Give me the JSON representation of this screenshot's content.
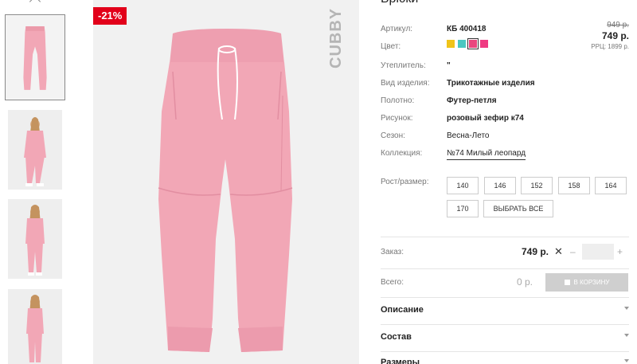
{
  "product": {
    "title": "Брюки",
    "discount_badge": "-21%",
    "brand": "CUBBY"
  },
  "details": {
    "article_label": "Артикул:",
    "article_value": "КБ 400418",
    "color_label": "Цвет:",
    "swatches": [
      {
        "color": "#f0c419",
        "selected": false
      },
      {
        "color": "#4ac7c1",
        "selected": false
      },
      {
        "color": "#e9467e",
        "selected": true
      },
      {
        "color": "#ef3a82",
        "selected": false
      }
    ],
    "insulation_label": "Утеплитель:",
    "insulation_value": "\"",
    "kind_label": "Вид изделия:",
    "kind_value": "Трикотажные изделия",
    "fabric_label": "Полотно:",
    "fabric_value": "Футер-петля",
    "pattern_label": "Рисунок:",
    "pattern_value": "розовый зефир к74",
    "season_label": "Сезон:",
    "season_value": "Весна-Лето",
    "collection_label": "Коллекция:",
    "collection_value": "№74 Милый леопард"
  },
  "price": {
    "old": "949 р.",
    "new": "749 р.",
    "rrc": "РРЦ: 1899 р."
  },
  "sizes": {
    "label": "Рост/размер:",
    "options": [
      "140",
      "146",
      "152",
      "158",
      "164",
      "170"
    ],
    "select_all": "ВЫБРАТЬ ВСЕ"
  },
  "order": {
    "label": "Заказ:",
    "price": "749 р.",
    "times": "✕",
    "minus": "–",
    "plus": "+",
    "quantity": ""
  },
  "total": {
    "label": "Всего:",
    "value": "0 р.",
    "cart_button": "В КОРЗИНУ"
  },
  "accordion": [
    "Описание",
    "Состав",
    "Размеры"
  ],
  "colors": {
    "accent_red": "#e2001a",
    "product_pink": "#f3a6b6"
  }
}
